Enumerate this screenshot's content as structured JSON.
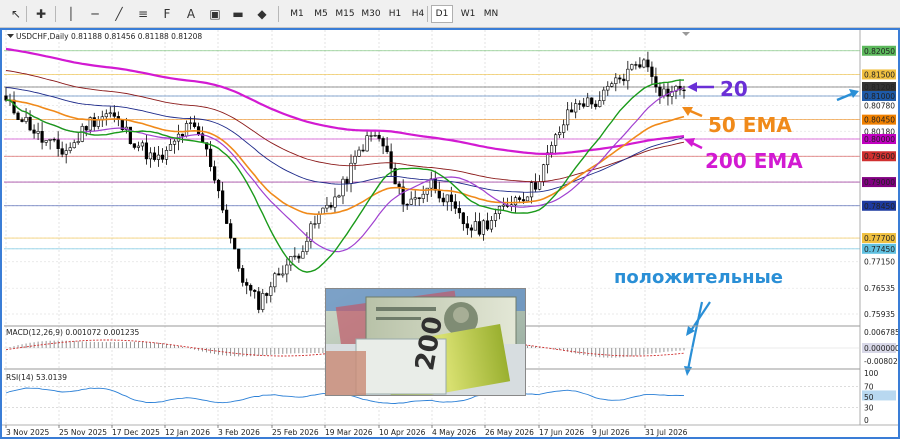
{
  "toolbar": {
    "timeframes": [
      "M1",
      "M5",
      "M15",
      "M30",
      "H1",
      "H4",
      "D1",
      "W1",
      "MN"
    ],
    "active_timeframe": "D1"
  },
  "chart_data": {
    "type": "candlestick",
    "symbol_header": "USDCHF,Daily  0.81188 0.81456 0.81188 0.81208",
    "price_axis_ticks": [
      "0.82050",
      "0.81500",
      "0.81208",
      "0.81000",
      "0.80780",
      "0.80450",
      "0.80180",
      "0.80000",
      "0.79600",
      "0.79000",
      "0.78450",
      "0.77700",
      "0.77450",
      "0.77150",
      "0.76535",
      "0.75935"
    ],
    "highlighted_levels": [
      {
        "label": "0.82050",
        "color": "#5cb85c"
      },
      {
        "label": "0.81500",
        "color": "#f0c040"
      },
      {
        "label": "0.81208",
        "color": "#333333"
      },
      {
        "label": "0.81000",
        "color": "#1e5aa8"
      },
      {
        "label": "0.80450",
        "color": "#f08000"
      },
      {
        "label": "0.80000",
        "color": "#c000c0"
      },
      {
        "label": "0.79600",
        "color": "#d03030"
      },
      {
        "label": "0.79000",
        "color": "#800080"
      },
      {
        "label": "0.78450",
        "color": "#1e3aa0"
      },
      {
        "label": "0.77700",
        "color": "#f0c040"
      },
      {
        "label": "0.77450",
        "color": "#60c0e0"
      }
    ],
    "time_labels": [
      "3 Nov 2025",
      "25 Nov 2025",
      "17 Dec 2025",
      "12 Jan 2026",
      "3 Feb 2026",
      "25 Feb 2026",
      "19 Mar 2026",
      "10 Apr 2026",
      "4 May 2026",
      "26 May 2026",
      "17 Jun 2026",
      "9 Jul 2026",
      "31 Jul 2026"
    ],
    "close_path": [
      0.8085,
      0.806,
      0.8035,
      0.8,
      0.7985,
      0.797,
      0.799,
      0.8035,
      0.805,
      0.806,
      0.803,
      0.8,
      0.7975,
      0.7945,
      0.7965,
      0.8005,
      0.803,
      0.8,
      0.793,
      0.783,
      0.772,
      0.765,
      0.762,
      0.766,
      0.77,
      0.772,
      0.776,
      0.781,
      0.785,
      0.787,
      0.793,
      0.7985,
      0.801,
      0.798,
      0.788,
      0.785,
      0.787,
      0.79,
      0.787,
      0.783,
      0.78,
      0.779,
      0.781,
      0.783,
      0.786,
      0.787,
      0.789,
      0.795,
      0.801,
      0.806,
      0.809,
      0.808,
      0.81,
      0.813,
      0.815,
      0.8185,
      0.8165,
      0.811,
      0.811,
      0.8121
    ],
    "moving_averages": [
      {
        "name": "20",
        "color": "#1a9a1a"
      },
      {
        "name": "50 EMA",
        "color": "#f08a1a"
      },
      {
        "name": "200 EMA",
        "color": "#d21ad2"
      }
    ],
    "annotations": [
      {
        "text": "20",
        "color": "#6a2fd6"
      },
      {
        "text": "50 EMA",
        "color": "#f08a1a"
      },
      {
        "text": "200 EMA",
        "color": "#d21ad2"
      },
      {
        "text": "положительные",
        "color": "#2a8fd6"
      }
    ],
    "macd": {
      "title": "MACD(12,26,9) 0.001072 0.001235",
      "ticks": [
        "0.006785",
        "0.000000",
        "-0.008023"
      ]
    },
    "rsi": {
      "title": "RSI(14) 53.0139",
      "ticks": [
        "100",
        "70",
        "50",
        "30",
        "0"
      ]
    }
  }
}
